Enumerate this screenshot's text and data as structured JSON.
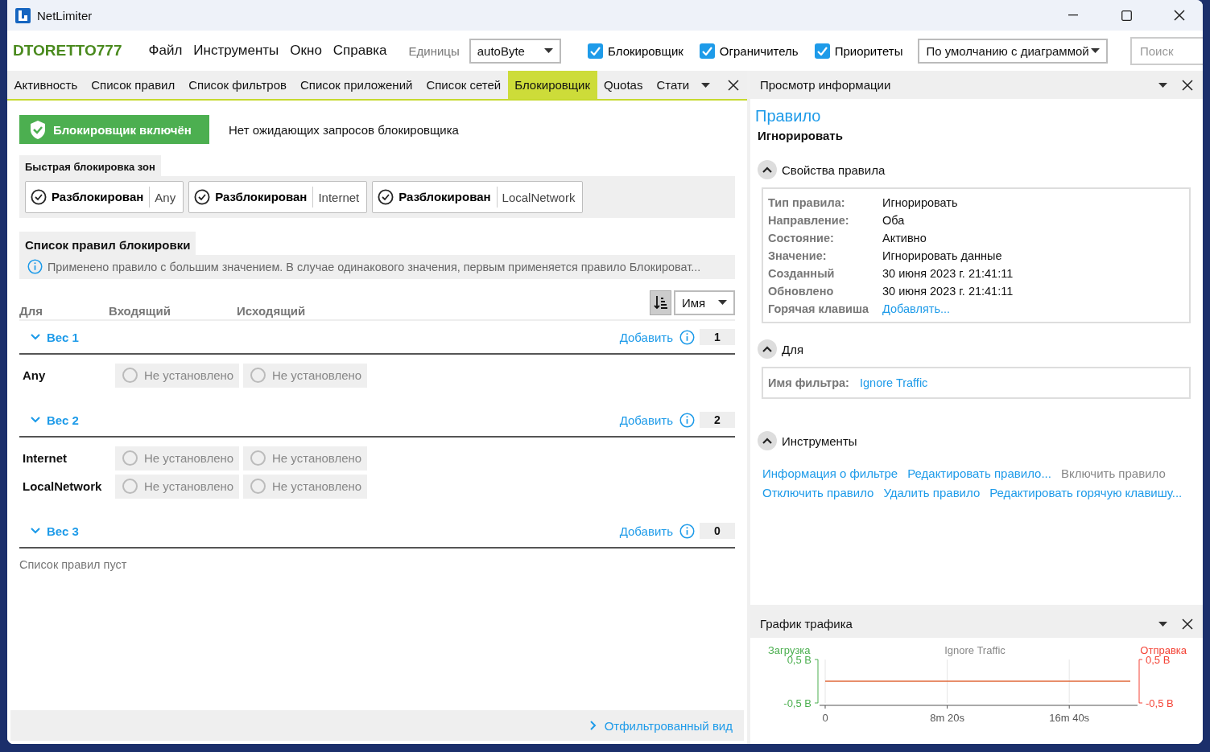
{
  "window": {
    "title": "NetLimiter"
  },
  "toolbar": {
    "host": "DTORETTO777",
    "menu": [
      "Файл",
      "Инструменты",
      "Окно",
      "Справка"
    ],
    "units_label": "Единицы",
    "units_value": "autoByte",
    "toggles": [
      {
        "label": "Блокировщик",
        "checked": true
      },
      {
        "label": "Ограничитель",
        "checked": true
      },
      {
        "label": "Приоритеты",
        "checked": true
      }
    ],
    "layout_value": "По умолчанию с диаграммой",
    "search": {
      "placeholder": "Поиск"
    }
  },
  "tabs": [
    {
      "label": "Активность",
      "selected": false
    },
    {
      "label": "Список правил",
      "selected": false
    },
    {
      "label": "Список фильтров",
      "selected": false
    },
    {
      "label": "Список приложений",
      "selected": false
    },
    {
      "label": "Список сетей",
      "selected": false
    },
    {
      "label": "Блокировщик",
      "selected": true
    },
    {
      "label": "Quotas",
      "selected": false
    },
    {
      "label": "Стати",
      "selected": false
    }
  ],
  "blocker": {
    "status": "Блокировщик включён",
    "enabled": true,
    "pending": "Нет ожидающих запросов блокировщика",
    "zones_title": "Быстрая блокировка зон",
    "zones": [
      {
        "state": "Разблокирован",
        "zone": "Any"
      },
      {
        "state": "Разблокирован",
        "zone": "Internet"
      },
      {
        "state": "Разблокирован",
        "zone": "LocalNetwork"
      }
    ],
    "rules_title": "Список правил блокировки",
    "info": "Применено правило с большим значением. В случае одинакового значения, первым применяется правило Блокироват...",
    "columns": [
      "Для",
      "Входящий",
      "Исходящий"
    ],
    "sort": "Имя",
    "groups": [
      {
        "title": "Вес 1",
        "expanded": true,
        "add": "Добавить",
        "count": "1",
        "rows": [
          {
            "name": "Any",
            "incoming": {
              "label": "Не установлено",
              "selected": false
            },
            "outgoing": {
              "label": "Не установлено",
              "selected": false
            }
          }
        ]
      },
      {
        "title": "Вес 2",
        "expanded": true,
        "add": "Добавить",
        "count": "2",
        "rows": [
          {
            "name": "Internet",
            "incoming": {
              "label": "Не установлено",
              "selected": false
            },
            "outgoing": {
              "label": "Не установлено",
              "selected": false
            }
          },
          {
            "name": "LocalNetwork",
            "incoming": {
              "label": "Не установлено",
              "selected": false
            },
            "outgoing": {
              "label": "Не установлено",
              "selected": false
            }
          }
        ]
      },
      {
        "title": "Вес 3",
        "expanded": true,
        "add": "Добавить",
        "count": "0",
        "empty": "Список правил пуст"
      }
    ],
    "footer": "Отфильтрованный вид"
  },
  "info_panel": {
    "title": "Просмотр информации",
    "heading": "Правило",
    "name": "Игнорировать",
    "sections": [
      {
        "title": "Свойства правила",
        "expanded": true,
        "props": [
          {
            "label": "Тип правила:",
            "value": "Игнорировать"
          },
          {
            "label": "Направление:",
            "value": "Оба"
          },
          {
            "label": "Состояние:",
            "value": "Активно"
          },
          {
            "label": "Значение:",
            "value": "Игнорировать данные"
          },
          {
            "label": "Созданный",
            "value": "30 июня 2023 г. 21:41:11"
          },
          {
            "label": "Обновлено",
            "value": "30 июня 2023 г. 21:41:11"
          },
          {
            "label": "Горячая клавиша",
            "value": "Добавлять...",
            "kind": "link"
          }
        ]
      },
      {
        "title": "Для",
        "expanded": true,
        "props": [
          {
            "label": "Имя фильтра:",
            "value": "Ignore Traffic",
            "kind": "link"
          }
        ]
      },
      {
        "title": "Инструменты",
        "expanded": true,
        "actions": [
          {
            "label": "Информация о фильтре",
            "disabled": false
          },
          {
            "label": "Редактировать правило...",
            "disabled": false
          },
          {
            "label": "Включить правило",
            "disabled": true
          },
          {
            "label": "Отключить правило",
            "disabled": false
          },
          {
            "label": "Удалить правило",
            "disabled": false
          },
          {
            "label": "Редактировать горячую клавишу...",
            "disabled": false
          }
        ]
      }
    ]
  },
  "graph_panel": {
    "title": "График трафика",
    "axis_labels": [
      {
        "label": "Загрузка",
        "color": "#4caf50"
      },
      {
        "label": "Отправка",
        "color": "#f44336"
      }
    ],
    "chart_data": {
      "type": "line",
      "title": "Ignore Traffic",
      "categories": [
        "0",
        null,
        "8m 20s",
        null,
        "16m 40s",
        null
      ],
      "series": [
        {
          "color": "#e0693a",
          "values": [
            0,
            0,
            0,
            0,
            0,
            0
          ]
        }
      ],
      "ylim": [
        -0.5,
        0.5
      ],
      "grid": true,
      "yticks": [
        {
          "value": -0.5,
          "label": "-0,5 B"
        },
        {
          "value": 0.5,
          "label": "0,5 B"
        }
      ]
    }
  }
}
